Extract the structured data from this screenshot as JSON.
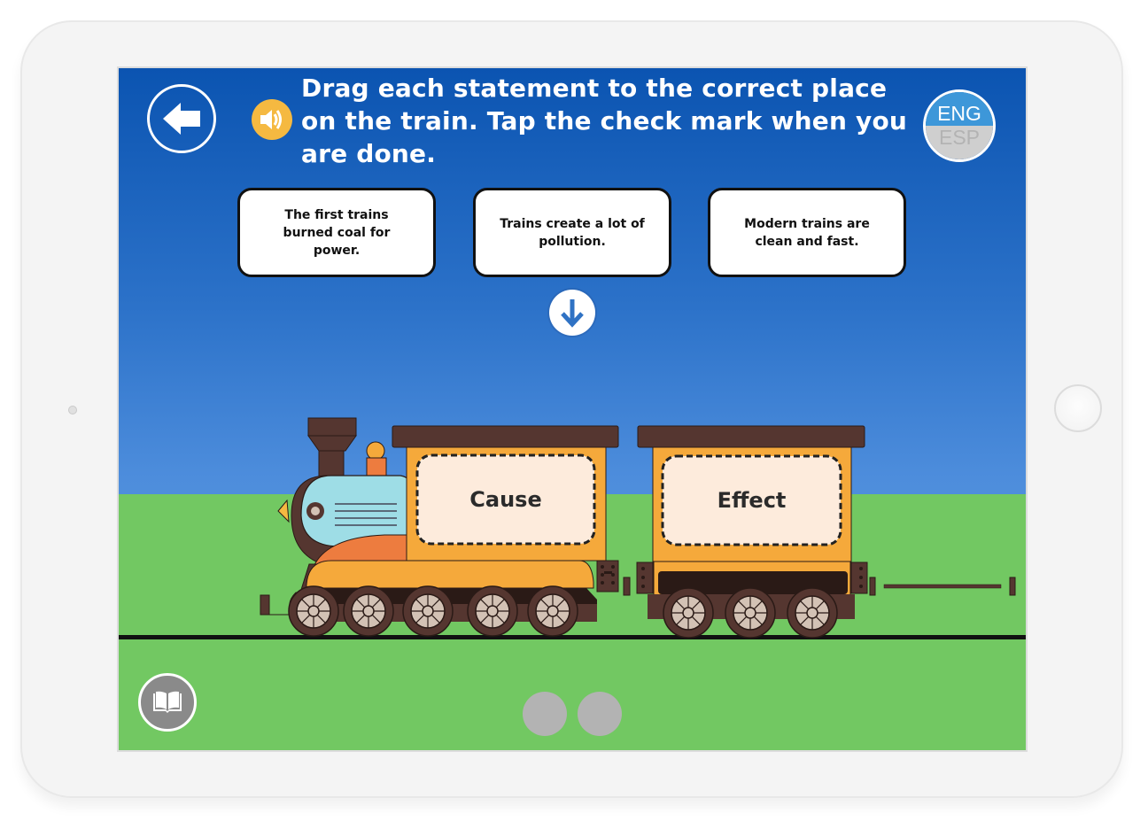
{
  "device": {
    "type": "tablet"
  },
  "header": {
    "back_icon": "arrow-left-icon",
    "audio_icon": "speaker-icon",
    "instruction": "Drag each statement to the correct place on the train. Tap the check mark when you are done.",
    "language": {
      "options": [
        "ENG",
        "ESP"
      ],
      "selected": "ENG"
    }
  },
  "statements": [
    {
      "text": "The first trains burned coal for power."
    },
    {
      "text": "Trains create a lot of pollution."
    },
    {
      "text": "Modern trains are clean and fast."
    }
  ],
  "scroll_down_icon": "arrow-down-icon",
  "train": {
    "drop_zones": [
      {
        "label": "Cause"
      },
      {
        "label": "Effect"
      }
    ]
  },
  "footer": {
    "book_icon": "book-icon",
    "page_dots": 2
  },
  "colors": {
    "sky_top": "#0b54b1",
    "sky_bottom": "#659fe4",
    "grass": "#72c862",
    "car_orange": "#f5a93b",
    "dark_brown": "#553630",
    "audio_yellow": "#f5b941",
    "eng_blue": "#3d97d9"
  }
}
